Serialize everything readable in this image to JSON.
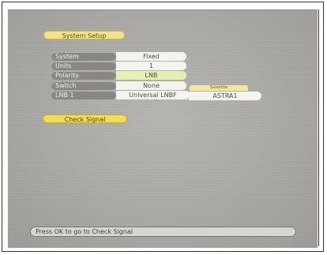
{
  "title": "System Setup",
  "rows": [
    {
      "label": "System",
      "value": "Fixed"
    },
    {
      "label": "Units",
      "value": "1"
    },
    {
      "label": "Polarity",
      "value": "LNB"
    },
    {
      "label": "Switch",
      "value": "None"
    },
    {
      "label": "LNB 1",
      "value": "Universal LNBF"
    }
  ],
  "satellite": {
    "header": "Satellite",
    "value": "ASTRA1"
  },
  "check_signal_label": "Check Signal",
  "footer_text": "Press OK to go to Check Signal"
}
